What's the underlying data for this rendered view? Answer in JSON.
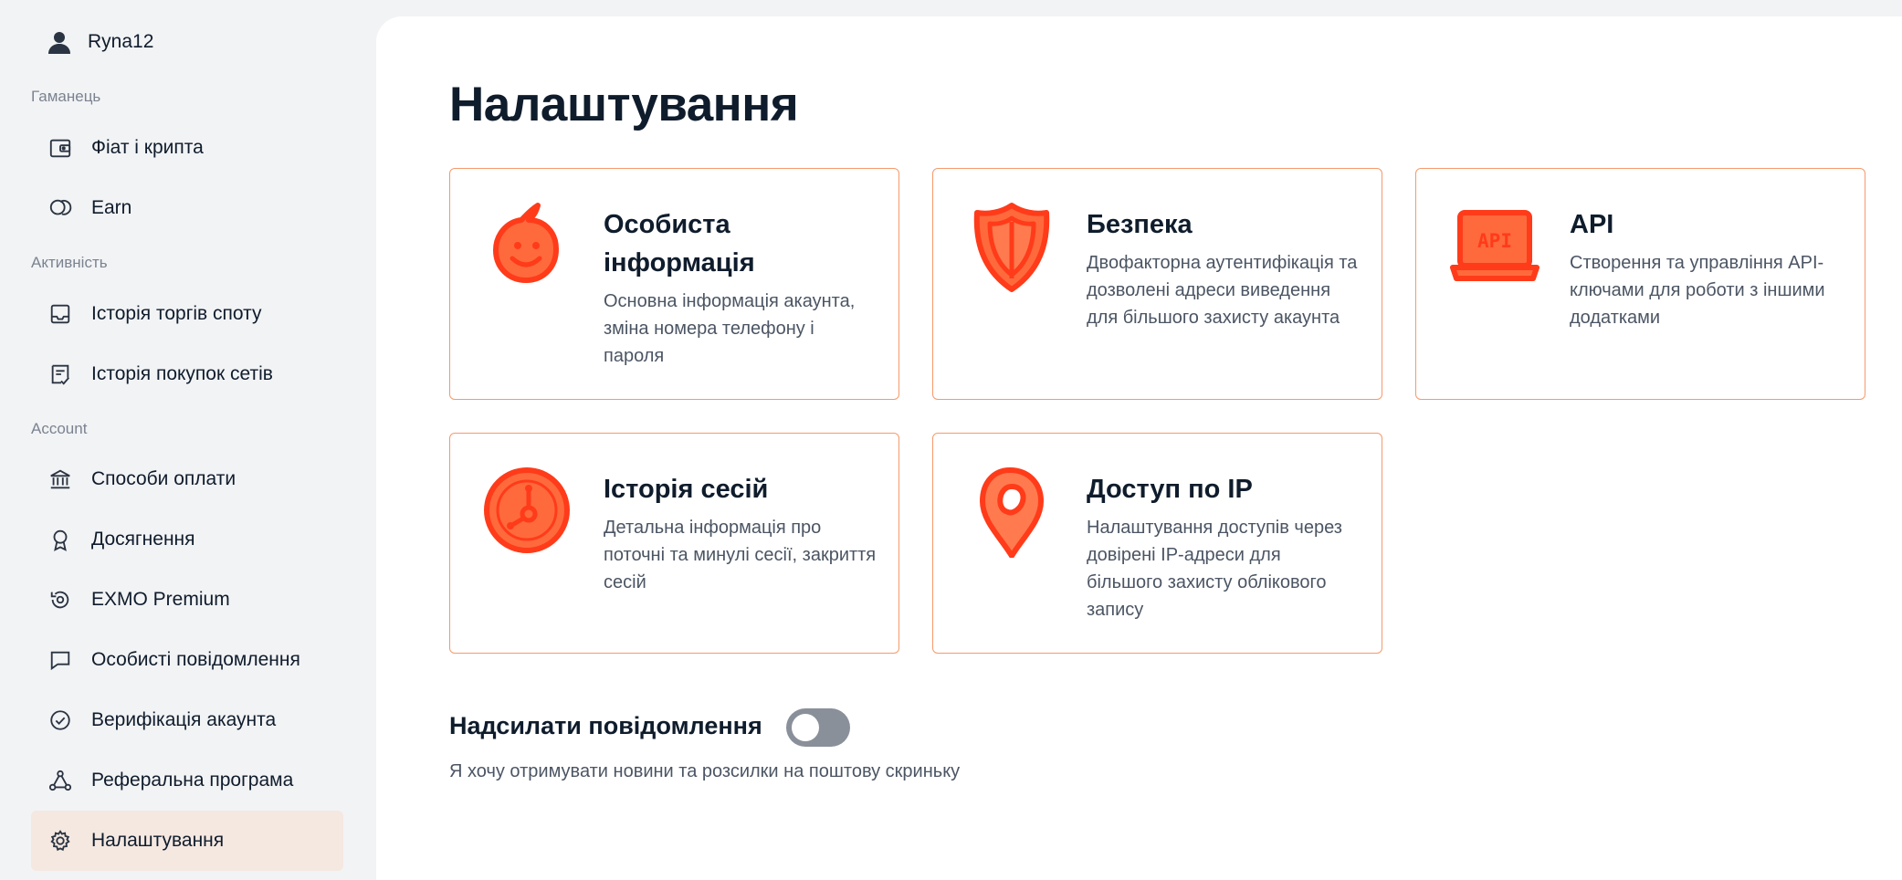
{
  "user": {
    "name": "Ryna12"
  },
  "sidebar": {
    "sections": [
      {
        "label": "Гаманець"
      },
      {
        "label": "Активність"
      },
      {
        "label": "Account"
      }
    ],
    "items": [
      {
        "label": "Фіат і крипта",
        "icon": "wallet-icon"
      },
      {
        "label": "Earn",
        "icon": "coins-icon"
      },
      {
        "label": "Історія торгів споту",
        "icon": "inbox-icon"
      },
      {
        "label": "Історія покупок сетів",
        "icon": "receipt-icon"
      },
      {
        "label": "Способи оплати",
        "icon": "bank-icon"
      },
      {
        "label": "Досягнення",
        "icon": "award-icon"
      },
      {
        "label": "EXMO Premium",
        "icon": "premium-icon"
      },
      {
        "label": "Особисті повідомлення",
        "icon": "message-icon"
      },
      {
        "label": "Верифікація акаунта",
        "icon": "check-circle-icon"
      },
      {
        "label": "Реферальна програма",
        "icon": "share-nodes-icon"
      },
      {
        "label": "Налаштування",
        "icon": "gear-icon",
        "active": true
      }
    ]
  },
  "main": {
    "title": "Налаштування",
    "cards": [
      {
        "title_lines": [
          "Особиста",
          "інформація"
        ],
        "description": "Основна інформація акаунта, зміна номера телефону і пароля",
        "icon": "smiley-bubble-icon"
      },
      {
        "title_lines": [
          "Безпека"
        ],
        "description": "Двофакторна аутентифікація та дозволені адреси виведення для більшого захисту акаунта",
        "icon": "shield-icon"
      },
      {
        "title_lines": [
          "API"
        ],
        "description": "Створення та управління API-ключами для роботи з іншими додатками",
        "icon": "laptop-api-icon",
        "icon_text": "API"
      },
      {
        "title_lines": [
          "Історія сесій"
        ],
        "description": "Детальна інформація про поточні та минулі сесії, закриття сесій",
        "icon": "clock-icon"
      },
      {
        "title_lines": [
          "Доступ по IP"
        ],
        "description": "Налаштування доступів через довірені IP-адреси для більшого захисту облікового запису",
        "icon": "map-pin-icon"
      }
    ],
    "notifications": {
      "title": "Надсилати повідомлення",
      "description": "Я хочу отримувати новини та розсилки на поштову скриньку",
      "enabled": false
    }
  },
  "colors": {
    "accent": "#ff3b1a",
    "accent_fill": "#ff6a3d",
    "card_border": "#f59a6c",
    "active_bg": "#f5e8e1",
    "toggle_off": "#8a9099"
  }
}
